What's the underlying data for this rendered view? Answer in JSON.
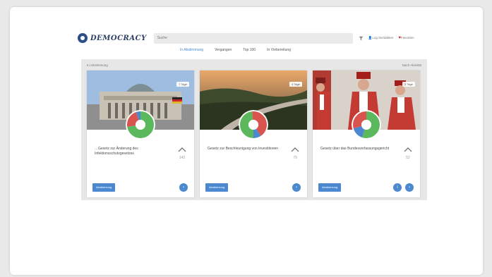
{
  "header": {
    "logo_text": "DEMOCRACY",
    "search_placeholder": "Suche",
    "user_label": "Log Sie/dakten",
    "favorite_label": "Favoriten"
  },
  "tabs": [
    {
      "label": "In Abstimmung",
      "active": true
    },
    {
      "label": "Vergangen",
      "active": false
    },
    {
      "label": "Top 100",
      "active": false
    },
    {
      "label": "In Vorbereitung",
      "active": false
    }
  ],
  "toolbar": {
    "left_label": "In Abstimmung",
    "right_label": "Nach Aktivität"
  },
  "cards": [
    {
      "badge": "7 Tage",
      "title": "…Gesetz zur Änderung des Infektionsschutzgesetzes",
      "votes": "142",
      "button_label": "Abstimmung",
      "image_icon": "reichstag-building",
      "donut": {
        "green": 0.72,
        "red": 0.22,
        "blue": 0.06
      }
    },
    {
      "badge": "4 Tage",
      "title": "Gesetz zur Beschleunigung von Investitionen",
      "votes": "79",
      "button_label": "Abstimmung",
      "image_icon": "highway-landscape",
      "donut": {
        "green": 0.48,
        "red": 0.42,
        "blue": 0.1
      }
    },
    {
      "badge": "2 Tage",
      "title": "Gesetz über das Bundesverfassungsgericht",
      "votes": "52",
      "button_label": "Abstimmung",
      "image_icon": "constitutional-court-judges",
      "donut": {
        "green": 0.55,
        "red": 0.3,
        "blue": 0.15
      }
    }
  ],
  "colors": {
    "accent": "#4b88d0",
    "green": "#5cb85c",
    "red": "#d9534f",
    "blue": "#4b88d0",
    "logo": "#2c4f86"
  }
}
